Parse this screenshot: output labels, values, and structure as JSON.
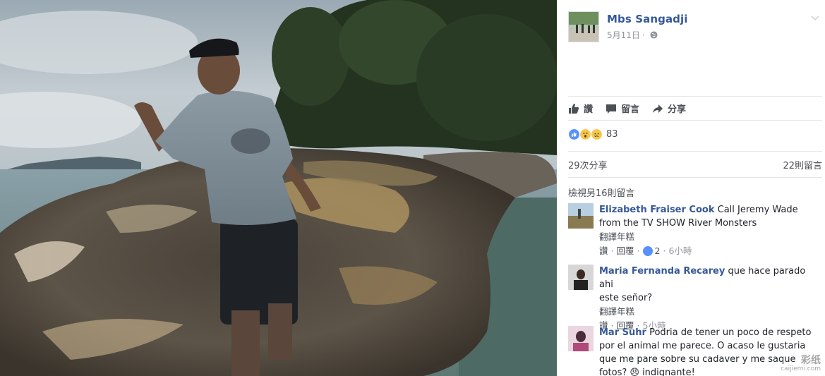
{
  "post": {
    "author": "Mbs Sangadji",
    "date": "5月11日",
    "privacy_icon": "globe-icon"
  },
  "actions": {
    "like_label": "讚",
    "comment_label": "留言",
    "share_label": "分享"
  },
  "reactions": {
    "icons": [
      "like-reaction-icon",
      "wow-reaction-icon",
      "sad-reaction-icon"
    ],
    "count": "83"
  },
  "stats": {
    "shares": "29次分享",
    "comments": "22則留言"
  },
  "more_comments": "檢視另16則留言",
  "comments": [
    {
      "author": "Elizabeth Fraiser Cook",
      "text_lines": [
        "Call Jeremy Wade",
        "from the TV SHOW River Monsters"
      ],
      "translate": "翻譯年糕",
      "like_label": "讚",
      "reply_label": "回覆",
      "likes": "2",
      "time": "6小時"
    },
    {
      "author": "Maria Fernanda Recarey",
      "text_lines": [
        "que hace parado ahi",
        "este señor?"
      ],
      "translate": "翻譯年糕",
      "like_label": "讚",
      "reply_label": "回覆",
      "time": "5小時"
    },
    {
      "author": "Mar Suhr",
      "text_lines": [
        "Podria de tener un poco de respeto",
        "por el animal me parece. O acaso le gustaria",
        "que me pare sobre su cadaver y me saque",
        "fotos? 😠 indignante!"
      ]
    }
  ],
  "watermark": {
    "text": "彩纸",
    "sub": "caijiemi.com"
  },
  "colors": {
    "link": "#365899",
    "text": "#1d2129",
    "muted": "#90949c",
    "like_blue": "#5890ff"
  }
}
